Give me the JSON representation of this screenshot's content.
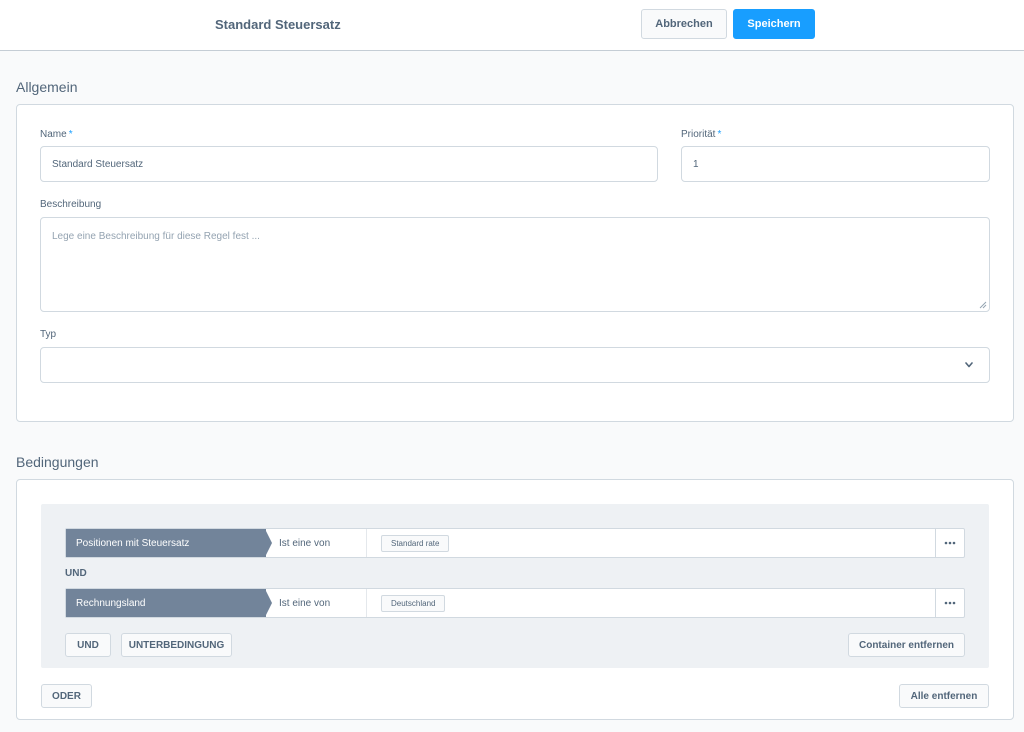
{
  "header": {
    "title": "Standard Steuersatz",
    "cancel_label": "Abbrechen",
    "save_label": "Speichern"
  },
  "general": {
    "section_title": "Allgemein",
    "name_label": "Name",
    "name_required": "*",
    "name_value": "Standard Steuersatz",
    "priority_label": "Priorität",
    "priority_required": "*",
    "priority_value": "1",
    "description_label": "Beschreibung",
    "description_placeholder": "Lege eine Beschreibung für diese Regel fest ...",
    "type_label": "Typ",
    "type_value": ""
  },
  "conditions": {
    "section_title": "Bedingungen",
    "rows": [
      {
        "field": "Positionen mit Steuersatz",
        "operator": "Ist eine von",
        "value": "Standard rate"
      },
      {
        "field": "Rechnungsland",
        "operator": "Ist eine von",
        "value": "Deutschland"
      }
    ],
    "and_connector": "UND",
    "and_button": "UND",
    "subcondition_button": "UNTERBEDINGUNG",
    "remove_container_button": "Container entfernen",
    "or_button": "ODER",
    "remove_all_button": "Alle entfernen",
    "more_icon": "ellipsis-icon"
  },
  "colors": {
    "accent": "#189eff",
    "condition_field_bg": "#72849a",
    "text": "#52667a"
  }
}
